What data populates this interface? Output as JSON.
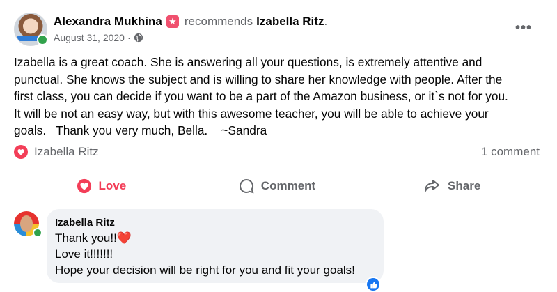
{
  "post": {
    "author": "Alexandra Mukhina",
    "recommends_text": "recommends",
    "page_name": "Izabella Ritz",
    "trailing_dot": ".",
    "date": "August 31, 2020",
    "separator": "·",
    "audience_icon": "globe-icon",
    "badge_icon": "recommend-star-icon",
    "more_icon": "•••",
    "text": "Izabella is a great coach. She is answering all your questions, is extremely attentive and\npunctual. She knows the subject and is willing to share her knowledge with people. After the\nfirst class, you can decide if you want to be a part of the Amazon business, or it`s not for you.\nIt will be not an easy way, but with this awesome teacher, you will be able to achieve your\ngoals.   Thank you very much, Bella.    ~Sandra"
  },
  "reactions": {
    "reactor_name": "Izabella Ritz",
    "comment_count": "1 comment"
  },
  "actions": {
    "love_label": "Love",
    "comment_label": "Comment",
    "share_label": "Share"
  },
  "comment": {
    "author": "Izabella Ritz",
    "line1": "Thank you!!",
    "line1_emoji": "❤️",
    "line2": "Love it!!!!!!!",
    "line3": "Hope your decision will be right for you and fit your goals!"
  },
  "colors": {
    "love_red": "#f33e58",
    "secondary_text": "#65676b",
    "bubble_bg": "#f0f2f5",
    "like_blue": "#1877f2",
    "online_green": "#31a24c"
  }
}
